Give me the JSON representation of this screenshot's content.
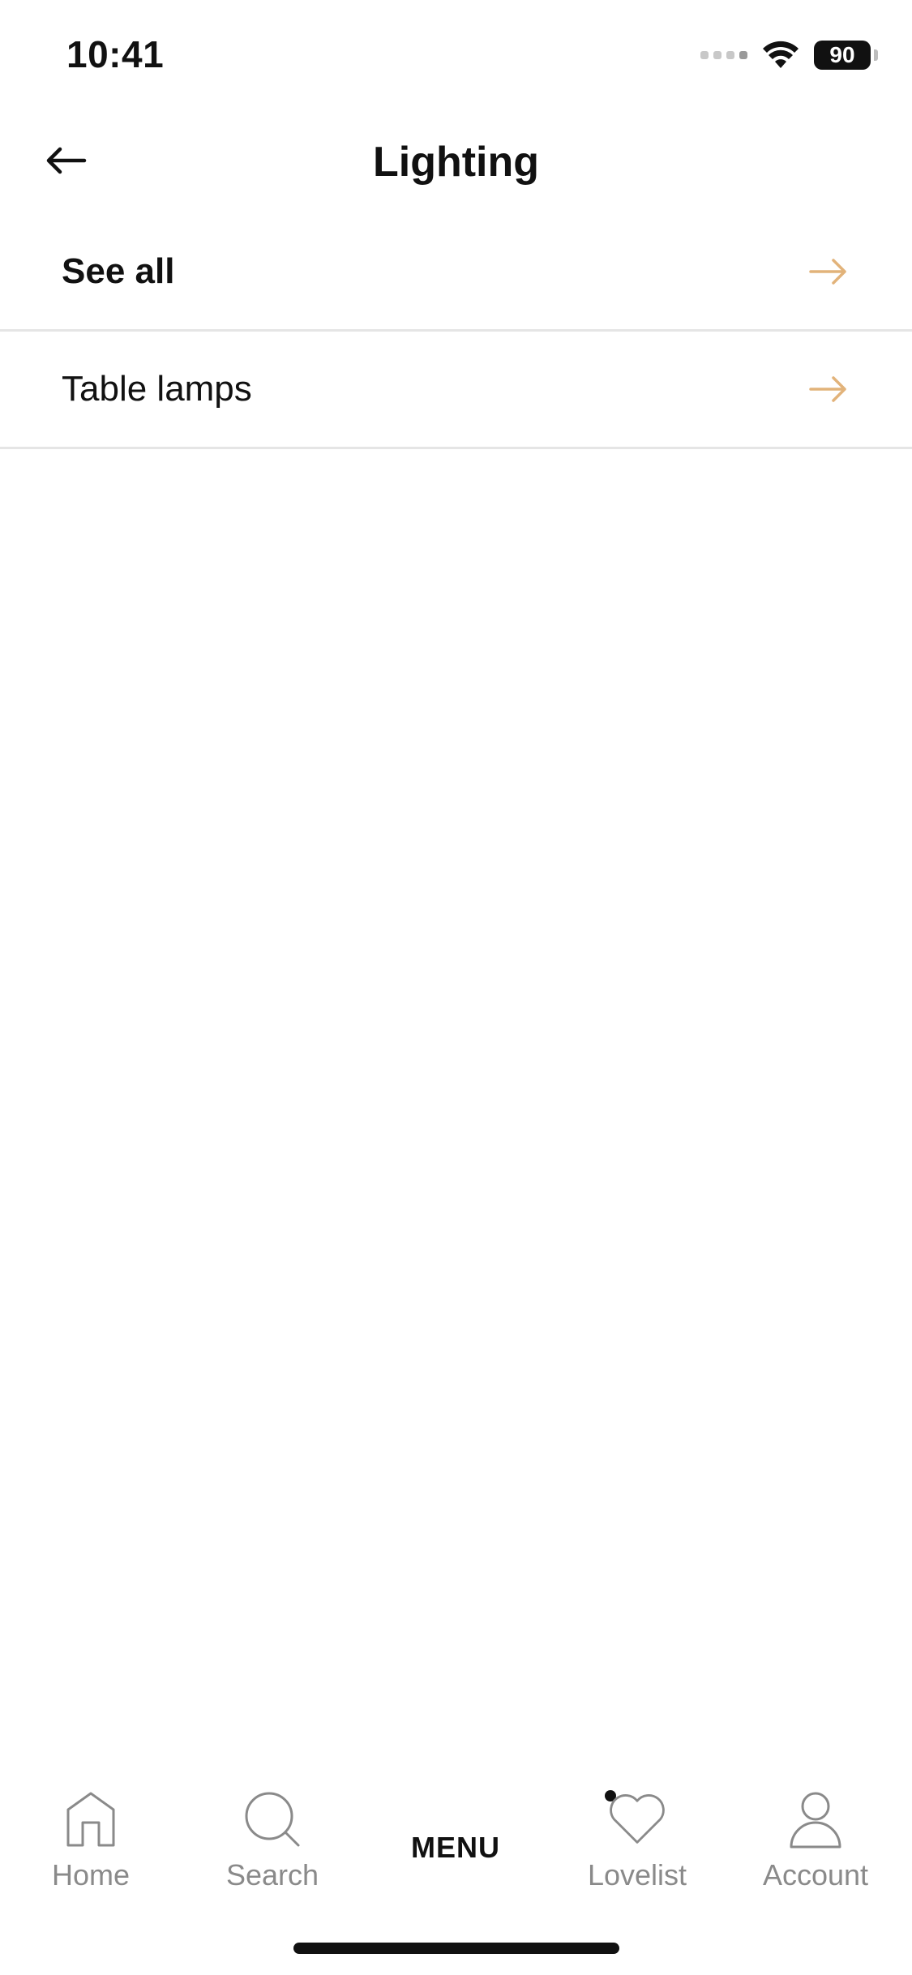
{
  "status_bar": {
    "time": "10:41",
    "battery": "90"
  },
  "header": {
    "title": "Lighting",
    "back_icon": "arrow-left-icon"
  },
  "list": {
    "items": [
      {
        "label": "See all",
        "bold": true,
        "icon": "arrow-right-icon"
      },
      {
        "label": "Table lamps",
        "bold": false,
        "icon": "arrow-right-icon"
      }
    ]
  },
  "tab_bar": {
    "tabs": [
      {
        "label": "Home",
        "icon": "home-icon"
      },
      {
        "label": "Search",
        "icon": "search-icon"
      },
      {
        "label": "MENU",
        "active": true
      },
      {
        "label": "Lovelist",
        "icon": "heart-icon"
      },
      {
        "label": "Account",
        "icon": "person-icon"
      }
    ]
  },
  "colors": {
    "accent_arrow": "#E2B37A",
    "text": "#111111",
    "inactive_tab": "#8A8A8A",
    "divider": "#E5E5E5"
  }
}
